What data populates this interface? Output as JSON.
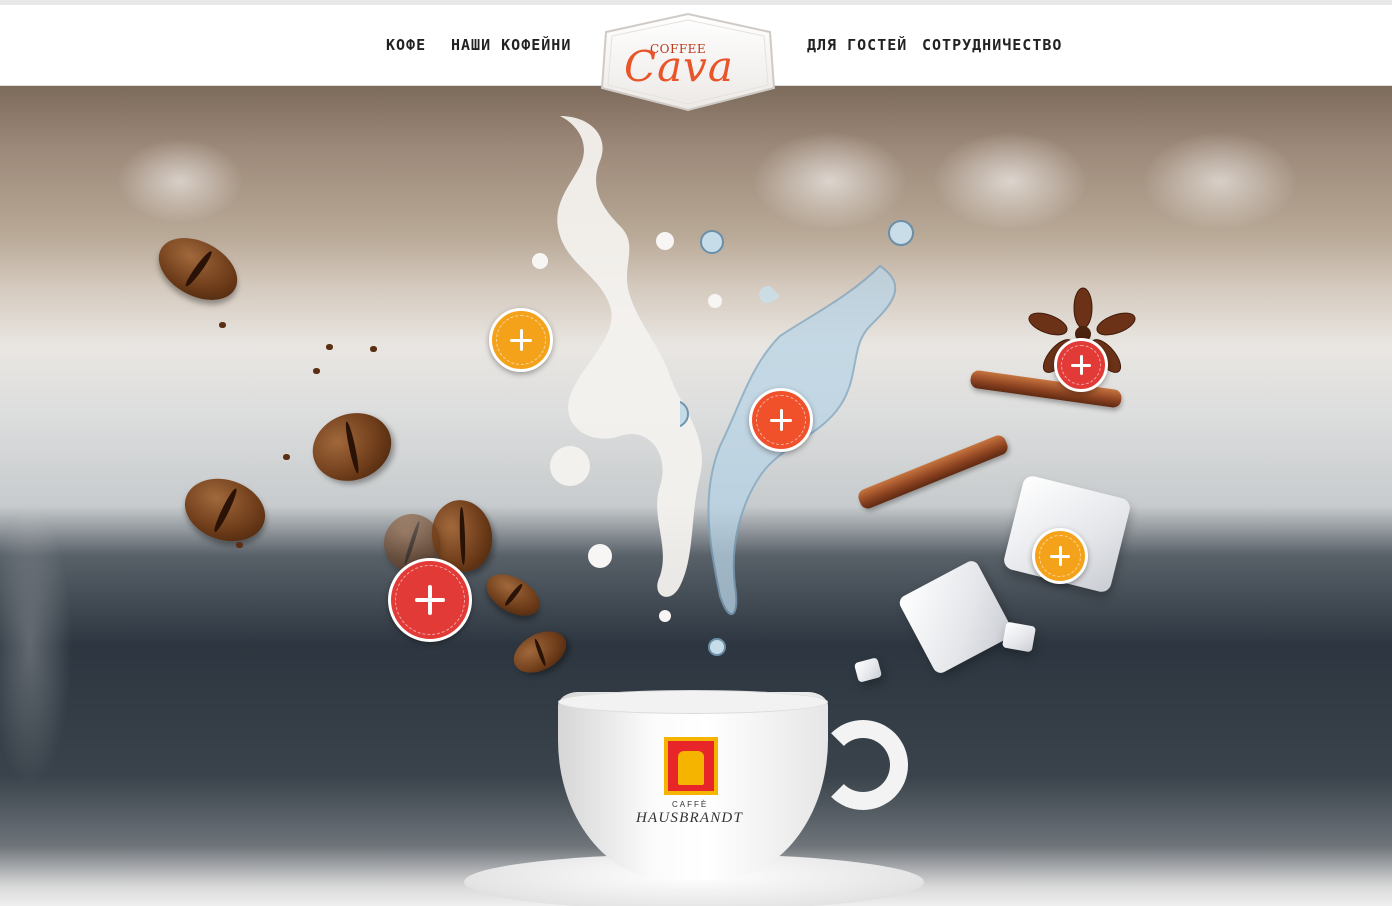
{
  "header": {
    "nav_left": [
      {
        "label": "КОФЕ"
      },
      {
        "label": "НАШИ КОФЕЙНИ"
      }
    ],
    "nav_right": [
      {
        "label": "ДЛЯ ГОСТЕЙ"
      },
      {
        "label": "СОТРУДНИЧЕСТВО"
      }
    ],
    "logo": {
      "small_text": "COFFEE",
      "big_text": "Cava"
    }
  },
  "hero": {
    "cup_brand": {
      "caffe": "CAFFÈ",
      "name": "HAUSBRANDT"
    },
    "hotspots": [
      {
        "name": "milk",
        "color": "#f5a21b"
      },
      {
        "name": "water",
        "color": "#f0502a"
      },
      {
        "name": "spices",
        "color": "#e23a36"
      },
      {
        "name": "sugar",
        "color": "#f5a21b"
      },
      {
        "name": "coffee-beans",
        "color": "#e23a36"
      }
    ]
  },
  "colors": {
    "accent_orange": "#f5a21b",
    "accent_coral": "#f0502a",
    "accent_red": "#e23a36",
    "logo_orange": "#e8552a"
  }
}
